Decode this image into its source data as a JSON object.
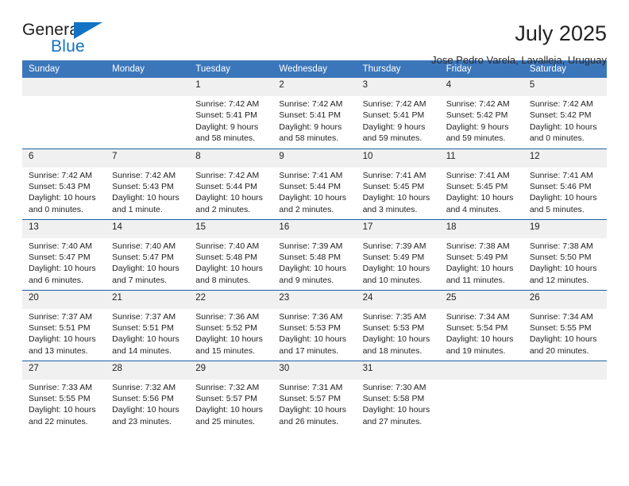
{
  "brand": {
    "name_top": "General",
    "name_bottom": "Blue",
    "accent_color": "#1273c4",
    "triangle_icon": "brand-triangle-icon"
  },
  "header": {
    "month_title": "July 2025",
    "location": "Jose Pedro Varela, Lavalleja, Uruguay"
  },
  "calendar": {
    "header_bg": "#3b76bb",
    "header_text_color": "#ffffff",
    "row_divider_color": "#1a5fa3",
    "daynum_bg": "#f0f0f0",
    "weekdays": [
      "Sunday",
      "Monday",
      "Tuesday",
      "Wednesday",
      "Thursday",
      "Friday",
      "Saturday"
    ],
    "weeks": [
      [
        {
          "day": "",
          "sunrise": "",
          "sunset": "",
          "daylight1": "",
          "daylight2": "",
          "empty": true
        },
        {
          "day": "",
          "sunrise": "",
          "sunset": "",
          "daylight1": "",
          "daylight2": "",
          "empty": true
        },
        {
          "day": "1",
          "sunrise": "Sunrise: 7:42 AM",
          "sunset": "Sunset: 5:41 PM",
          "daylight1": "Daylight: 9 hours",
          "daylight2": "and 58 minutes."
        },
        {
          "day": "2",
          "sunrise": "Sunrise: 7:42 AM",
          "sunset": "Sunset: 5:41 PM",
          "daylight1": "Daylight: 9 hours",
          "daylight2": "and 58 minutes."
        },
        {
          "day": "3",
          "sunrise": "Sunrise: 7:42 AM",
          "sunset": "Sunset: 5:41 PM",
          "daylight1": "Daylight: 9 hours",
          "daylight2": "and 59 minutes."
        },
        {
          "day": "4",
          "sunrise": "Sunrise: 7:42 AM",
          "sunset": "Sunset: 5:42 PM",
          "daylight1": "Daylight: 9 hours",
          "daylight2": "and 59 minutes."
        },
        {
          "day": "5",
          "sunrise": "Sunrise: 7:42 AM",
          "sunset": "Sunset: 5:42 PM",
          "daylight1": "Daylight: 10 hours",
          "daylight2": "and 0 minutes."
        }
      ],
      [
        {
          "day": "6",
          "sunrise": "Sunrise: 7:42 AM",
          "sunset": "Sunset: 5:43 PM",
          "daylight1": "Daylight: 10 hours",
          "daylight2": "and 0 minutes."
        },
        {
          "day": "7",
          "sunrise": "Sunrise: 7:42 AM",
          "sunset": "Sunset: 5:43 PM",
          "daylight1": "Daylight: 10 hours",
          "daylight2": "and 1 minute."
        },
        {
          "day": "8",
          "sunrise": "Sunrise: 7:42 AM",
          "sunset": "Sunset: 5:44 PM",
          "daylight1": "Daylight: 10 hours",
          "daylight2": "and 2 minutes."
        },
        {
          "day": "9",
          "sunrise": "Sunrise: 7:41 AM",
          "sunset": "Sunset: 5:44 PM",
          "daylight1": "Daylight: 10 hours",
          "daylight2": "and 2 minutes."
        },
        {
          "day": "10",
          "sunrise": "Sunrise: 7:41 AM",
          "sunset": "Sunset: 5:45 PM",
          "daylight1": "Daylight: 10 hours",
          "daylight2": "and 3 minutes."
        },
        {
          "day": "11",
          "sunrise": "Sunrise: 7:41 AM",
          "sunset": "Sunset: 5:45 PM",
          "daylight1": "Daylight: 10 hours",
          "daylight2": "and 4 minutes."
        },
        {
          "day": "12",
          "sunrise": "Sunrise: 7:41 AM",
          "sunset": "Sunset: 5:46 PM",
          "daylight1": "Daylight: 10 hours",
          "daylight2": "and 5 minutes."
        }
      ],
      [
        {
          "day": "13",
          "sunrise": "Sunrise: 7:40 AM",
          "sunset": "Sunset: 5:47 PM",
          "daylight1": "Daylight: 10 hours",
          "daylight2": "and 6 minutes."
        },
        {
          "day": "14",
          "sunrise": "Sunrise: 7:40 AM",
          "sunset": "Sunset: 5:47 PM",
          "daylight1": "Daylight: 10 hours",
          "daylight2": "and 7 minutes."
        },
        {
          "day": "15",
          "sunrise": "Sunrise: 7:40 AM",
          "sunset": "Sunset: 5:48 PM",
          "daylight1": "Daylight: 10 hours",
          "daylight2": "and 8 minutes."
        },
        {
          "day": "16",
          "sunrise": "Sunrise: 7:39 AM",
          "sunset": "Sunset: 5:48 PM",
          "daylight1": "Daylight: 10 hours",
          "daylight2": "and 9 minutes."
        },
        {
          "day": "17",
          "sunrise": "Sunrise: 7:39 AM",
          "sunset": "Sunset: 5:49 PM",
          "daylight1": "Daylight: 10 hours",
          "daylight2": "and 10 minutes."
        },
        {
          "day": "18",
          "sunrise": "Sunrise: 7:38 AM",
          "sunset": "Sunset: 5:49 PM",
          "daylight1": "Daylight: 10 hours",
          "daylight2": "and 11 minutes."
        },
        {
          "day": "19",
          "sunrise": "Sunrise: 7:38 AM",
          "sunset": "Sunset: 5:50 PM",
          "daylight1": "Daylight: 10 hours",
          "daylight2": "and 12 minutes."
        }
      ],
      [
        {
          "day": "20",
          "sunrise": "Sunrise: 7:37 AM",
          "sunset": "Sunset: 5:51 PM",
          "daylight1": "Daylight: 10 hours",
          "daylight2": "and 13 minutes."
        },
        {
          "day": "21",
          "sunrise": "Sunrise: 7:37 AM",
          "sunset": "Sunset: 5:51 PM",
          "daylight1": "Daylight: 10 hours",
          "daylight2": "and 14 minutes."
        },
        {
          "day": "22",
          "sunrise": "Sunrise: 7:36 AM",
          "sunset": "Sunset: 5:52 PM",
          "daylight1": "Daylight: 10 hours",
          "daylight2": "and 15 minutes."
        },
        {
          "day": "23",
          "sunrise": "Sunrise: 7:36 AM",
          "sunset": "Sunset: 5:53 PM",
          "daylight1": "Daylight: 10 hours",
          "daylight2": "and 17 minutes."
        },
        {
          "day": "24",
          "sunrise": "Sunrise: 7:35 AM",
          "sunset": "Sunset: 5:53 PM",
          "daylight1": "Daylight: 10 hours",
          "daylight2": "and 18 minutes."
        },
        {
          "day": "25",
          "sunrise": "Sunrise: 7:34 AM",
          "sunset": "Sunset: 5:54 PM",
          "daylight1": "Daylight: 10 hours",
          "daylight2": "and 19 minutes."
        },
        {
          "day": "26",
          "sunrise": "Sunrise: 7:34 AM",
          "sunset": "Sunset: 5:55 PM",
          "daylight1": "Daylight: 10 hours",
          "daylight2": "and 20 minutes."
        }
      ],
      [
        {
          "day": "27",
          "sunrise": "Sunrise: 7:33 AM",
          "sunset": "Sunset: 5:55 PM",
          "daylight1": "Daylight: 10 hours",
          "daylight2": "and 22 minutes."
        },
        {
          "day": "28",
          "sunrise": "Sunrise: 7:32 AM",
          "sunset": "Sunset: 5:56 PM",
          "daylight1": "Daylight: 10 hours",
          "daylight2": "and 23 minutes."
        },
        {
          "day": "29",
          "sunrise": "Sunrise: 7:32 AM",
          "sunset": "Sunset: 5:57 PM",
          "daylight1": "Daylight: 10 hours",
          "daylight2": "and 25 minutes."
        },
        {
          "day": "30",
          "sunrise": "Sunrise: 7:31 AM",
          "sunset": "Sunset: 5:57 PM",
          "daylight1": "Daylight: 10 hours",
          "daylight2": "and 26 minutes."
        },
        {
          "day": "31",
          "sunrise": "Sunrise: 7:30 AM",
          "sunset": "Sunset: 5:58 PM",
          "daylight1": "Daylight: 10 hours",
          "daylight2": "and 27 minutes."
        },
        {
          "day": "",
          "sunrise": "",
          "sunset": "",
          "daylight1": "",
          "daylight2": "",
          "empty": true
        },
        {
          "day": "",
          "sunrise": "",
          "sunset": "",
          "daylight1": "",
          "daylight2": "",
          "empty": true
        }
      ]
    ]
  }
}
